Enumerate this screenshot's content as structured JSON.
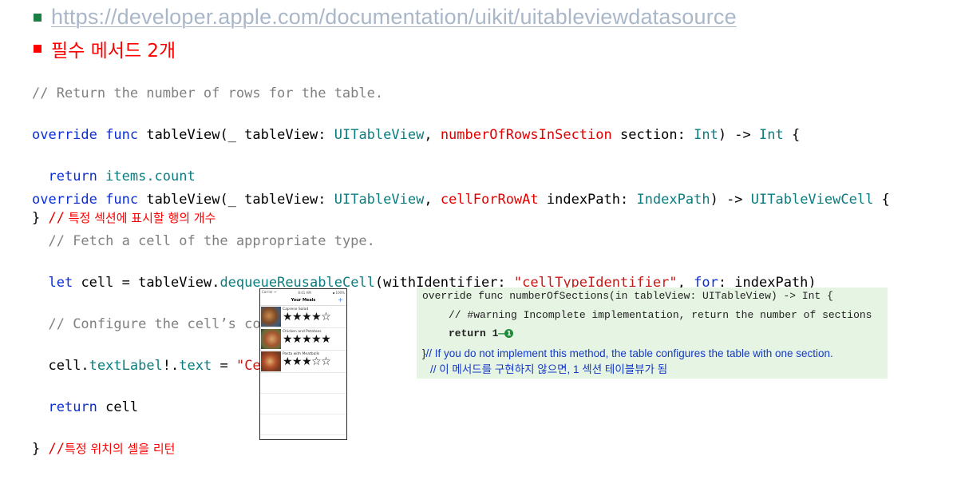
{
  "header": {
    "link_text": "https://developer.apple.com/documentation/uikit/uitableviewdatasource",
    "subtitle": "필수 메서드 2개",
    "bullet_green": "#1a7f45",
    "bullet_red": "#ff0000"
  },
  "code1": {
    "comment": "// Return the number of rows for the table.",
    "l2_kw1": "override",
    "l2_kw2": "func",
    "l2_name": " tableView(_ tableView: ",
    "l2_type": "UITableView",
    "l2_sep": ", ",
    "l2_param": "numberOfRowsInSection",
    "l2_rest": " section: ",
    "l2_type2": "Int",
    "l2_arrow": ") -> ",
    "l2_type3": "Int",
    "l2_brace": " {",
    "l3_kw": "return",
    "l3_val": " items.count",
    "l4_brace": "}",
    "l4_slashes": " //",
    "l4_note": " 특정 섹션에 표시할 행의 개수"
  },
  "code2": {
    "l1_kw1": "override",
    "l1_kw2": "func",
    "l1_name": " tableView(_ tableView: ",
    "l1_type": "UITableView",
    "l1_sep": ", ",
    "l1_param": "cellForRowAt",
    "l1_rest": " indexPath: ",
    "l1_type2": "IndexPath",
    "l1_arrow": ") -> ",
    "l1_type3": "UITableViewCell",
    "l1_brace": " {",
    "l2_comment": "// Fetch a cell of the appropriate type.",
    "l3_kw": "let",
    "l3_a": " cell = tableView.",
    "l3_method": "dequeueReusableCell",
    "l3_b": "(withIdentifier: ",
    "l3_str": "\"cellTypeIdentifier\"",
    "l3_c": ", ",
    "l3_kw2": "for",
    "l3_d": ": indexPath)",
    "l4_comment": "// Configure the cell’s contents.",
    "l5_a": "cell.",
    "l5_prop": "textLabel",
    "l5_b": "!.",
    "l5_prop2": "text",
    "l5_c": " = ",
    "l5_str": "\"Cell text\"",
    "l6_kw": "return",
    "l6_val": " cell",
    "l7_brace": "}",
    "l7_slashes": " //",
    "l7_note": "특정 위치의 셀을 리턴"
  },
  "phone": {
    "carrier": "Carrier ᯤ",
    "time": "8:41 AM",
    "battery": "▪ 100%",
    "title": "Your Meals",
    "add_icon": "+",
    "meals": [
      {
        "name": "Caprese Salad",
        "stars": "★★★★☆",
        "rating": 4
      },
      {
        "name": "Chicken and Potatoes",
        "stars": "★★★★★",
        "rating": 5
      },
      {
        "name": "Pasta with Meatballs",
        "stars": "★★★☆☆",
        "rating": 3
      }
    ]
  },
  "panel": {
    "l1": "override func numberOfSections(in tableView: UITableView) -> Int {",
    "l2": "// #warning Incomplete implementation, return the number of sections",
    "l3_kw": "return",
    "l3_val": " 1",
    "l3_dash": "—",
    "l3_marker": "1",
    "l4_brace": "}",
    "l4_note": "// If you do not implement this method, the table configures the table with one section.",
    "l5_note": "// 이 메서드를 구현하지 않으면, 1 섹션 테이블뷰가 됨"
  }
}
